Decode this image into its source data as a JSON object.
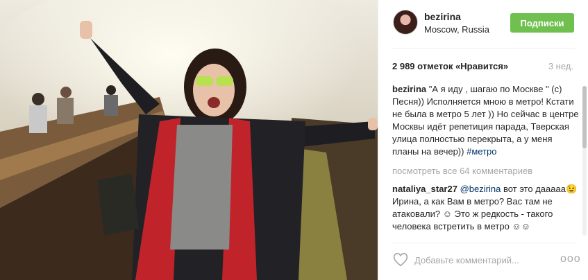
{
  "post": {
    "username": "bezirina",
    "location": "Moscow, Russia",
    "follow_label": "Подписки",
    "likes": "2 989 отметок «Нравится»",
    "time_ago": "3 нед.",
    "caption_user": "bezirina",
    "caption_text": "\"А я иду , шагаю по Москве \" (с) Песня)) Исполняется мною в метро! Кстати не была в метро 5 лет )) Но сейчас в центре Москвы идёт репетиция парада, Тверская улица полностью перекрыта, а у меня планы на вечер))",
    "caption_tag": "#метро",
    "view_all": "посмотреть все 64 комментариев",
    "comment": {
      "user": "nataliya_star27",
      "mention": "@bezirina",
      "text": "вот это дааааа😉 Ирина, а как Вам в метро? Вас там не атаковали? ☺ Это ж редкость - такого человека встретить в метро ☺☺"
    },
    "comment_placeholder": "Добавьте комментарий...",
    "more_label": "ooo",
    "colors": {
      "follow_button": "#70c050",
      "link": "#003569",
      "muted": "#a5a7aa"
    }
  },
  "icons": {
    "heart": "heart-outline-icon",
    "more": "more-options-icon"
  }
}
